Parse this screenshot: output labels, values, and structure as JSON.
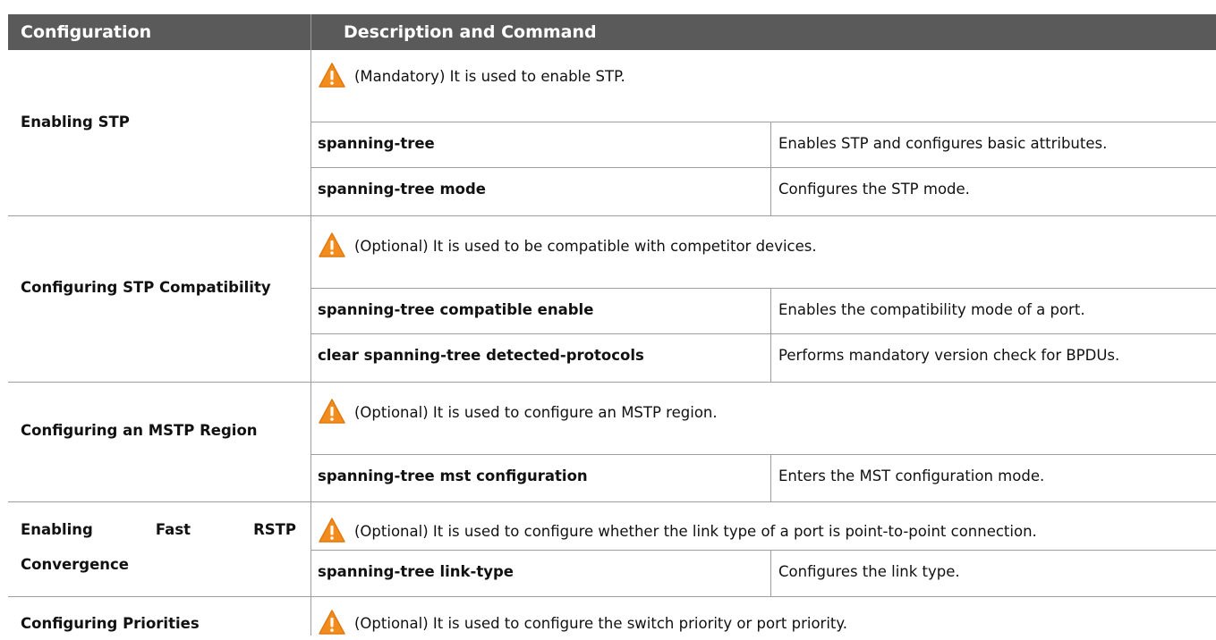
{
  "header": {
    "col1": "Configuration",
    "col2": "Description and Command"
  },
  "rows": [
    {
      "config": "Enabling STP",
      "note": "(Mandatory) It is used to enable STP.",
      "commands": [
        {
          "command": "spanning-tree",
          "description": "Enables STP and configures basic attributes."
        },
        {
          "command": "spanning-tree mode",
          "description": "Configures the STP mode."
        }
      ]
    },
    {
      "config": "Configuring STP Compatibility",
      "note": "(Optional) It is used to be compatible with competitor devices.",
      "commands": [
        {
          "command": "spanning-tree compatible enable",
          "description": "Enables the compatibility mode of a port."
        },
        {
          "command": "clear spanning-tree detected-protocols",
          "description": "Performs mandatory version check for BPDUs."
        }
      ]
    },
    {
      "config": "Configuring an MSTP Region",
      "note": "(Optional) It is used to configure an MSTP region.",
      "commands": [
        {
          "command": "spanning-tree mst configuration",
          "description": "Enters the MST configuration mode."
        }
      ]
    },
    {
      "config_words": [
        "Enabling",
        "Fast",
        "RSTP"
      ],
      "config_line2": "Convergence",
      "note": "(Optional) It is used to configure whether the link type of a port is point-to-point connection.",
      "commands": [
        {
          "command": "spanning-tree link-type",
          "description": "Configures the link type."
        }
      ]
    },
    {
      "config": "Configuring Priorities",
      "note": "(Optional) It is used to configure the switch priority or port priority."
    }
  ],
  "icons": {
    "warning": "warning-triangle-icon"
  },
  "colors": {
    "header_bg": "#5a5a5a",
    "warning_orange": "#f28c1c",
    "border": "#9e9e9e"
  }
}
